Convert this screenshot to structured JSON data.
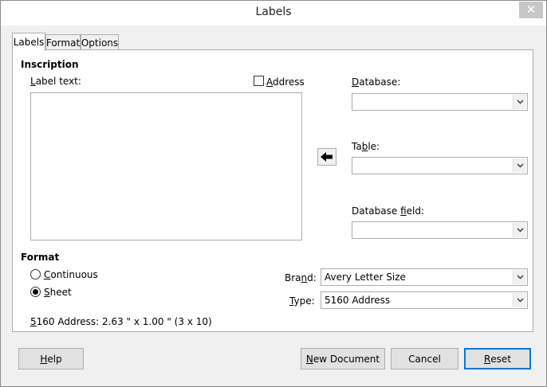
{
  "window": {
    "title": "Labels",
    "close_glyph": "✕"
  },
  "tabs": [
    {
      "label": "Labels",
      "active": true
    },
    {
      "label": "Format",
      "active": false
    },
    {
      "label": "Options",
      "active": false
    }
  ],
  "inscription": {
    "heading": "Inscription",
    "label_text": {
      "pre": "",
      "mnemonic": "L",
      "post": "abel text:"
    },
    "label_text_value": "",
    "address_checkbox": {
      "pre": "",
      "mnemonic": "A",
      "post": "ddress",
      "checked": false
    }
  },
  "database": {
    "database_label": {
      "pre": "",
      "mnemonic": "D",
      "post": "atabase:"
    },
    "database_value": "",
    "table_label": {
      "pre": "Ta",
      "mnemonic": "b",
      "post": "le:"
    },
    "table_value": "",
    "field_label": {
      "pre": "Database ",
      "mnemonic": "f",
      "post": "ield:"
    },
    "field_value": ""
  },
  "format": {
    "heading": "Format",
    "continuous": {
      "pre": "",
      "mnemonic": "C",
      "post": "ontinuous",
      "checked": false
    },
    "sheet": {
      "pre": "",
      "mnemonic": "S",
      "post": "heet",
      "checked": true
    },
    "brand_label": {
      "pre": "Bra",
      "mnemonic": "n",
      "post": "d:"
    },
    "brand_value": "Avery Letter Size",
    "type_label": {
      "pre": "",
      "mnemonic": "T",
      "post": "ype:"
    },
    "type_value": "5160 Address",
    "info": {
      "mnemonic": "5",
      "post": "160 Address: 2.63 \" x 1.00 \" (3 x 10)"
    }
  },
  "buttons": {
    "help": {
      "pre": "",
      "mnemonic": "H",
      "post": "elp"
    },
    "new_document": {
      "pre": "",
      "mnemonic": "N",
      "post": "ew Document"
    },
    "cancel": "Cancel",
    "reset": {
      "pre": "",
      "mnemonic": "R",
      "post": "eset"
    }
  },
  "colors": {
    "accent": "#0078d7",
    "panel_bg": "#ffffff",
    "window_bg": "#f0f0f0"
  }
}
